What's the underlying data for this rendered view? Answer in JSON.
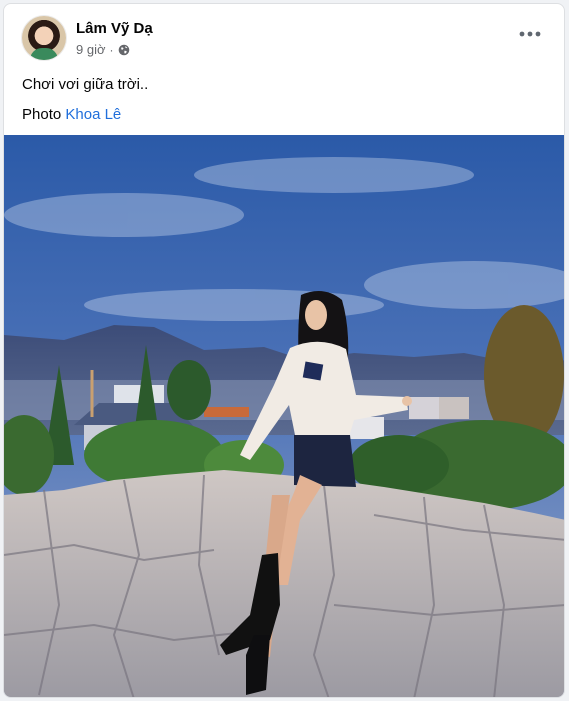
{
  "post": {
    "author_name": "Lâm Vỹ Dạ",
    "time_ago": "9 giờ",
    "separator": "·",
    "privacy_icon": "globe-icon",
    "more_icon": "more-options-icon",
    "text": "Chơi vơi giữa trời..",
    "credit_prefix": "Photo",
    "credit_name": "Khoa Lê"
  },
  "colors": {
    "link": "#216fdb",
    "secondary_text": "#65676b",
    "sky_top": "#2f5fb0",
    "sky_bottom": "#8aa0c8"
  }
}
